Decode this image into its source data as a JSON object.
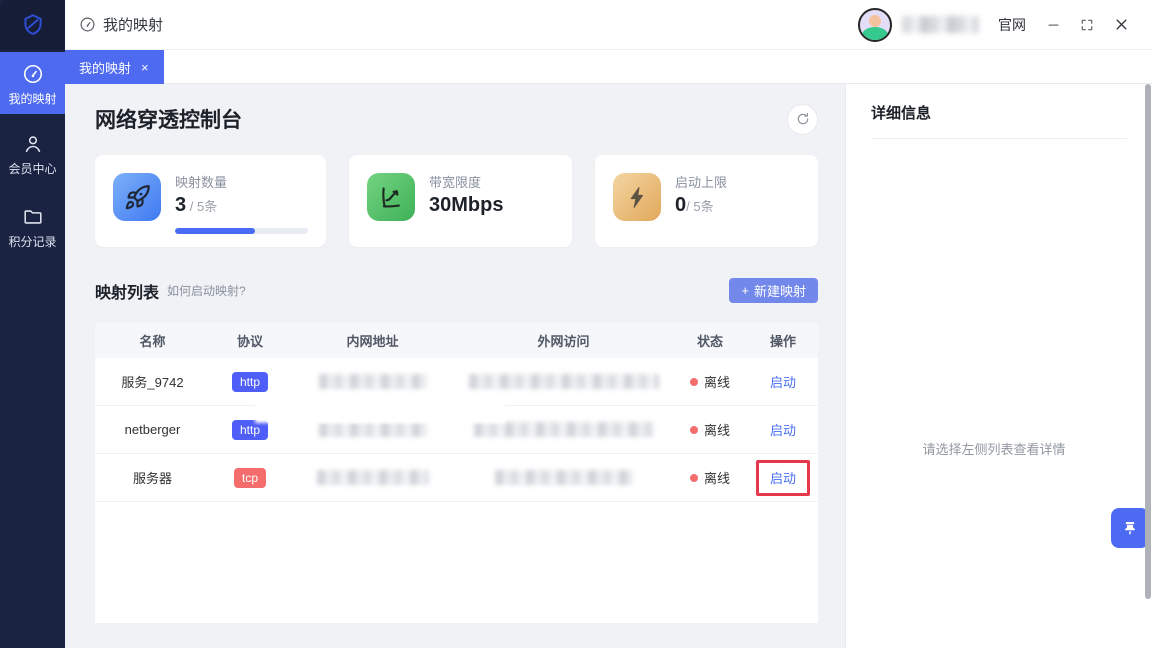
{
  "topbar": {
    "title": "我的映射",
    "portal_label": "官网"
  },
  "tab": {
    "label": "我的映射",
    "close": "×"
  },
  "sidebar": {
    "items": [
      {
        "label": "我的映射",
        "icon": "gauge-icon",
        "active": true
      },
      {
        "label": "会员中心",
        "icon": "user-icon",
        "active": false
      },
      {
        "label": "积分记录",
        "icon": "folder-icon",
        "active": false
      }
    ]
  },
  "page": {
    "title": "网络穿透控制台"
  },
  "stats": [
    {
      "label": "映射数量",
      "value": "3",
      "suffix": " / 5条",
      "icon": "rocket-icon",
      "progress_percent": 60
    },
    {
      "label": "带宽限度",
      "value": "30Mbps",
      "suffix": "",
      "icon": "trend-icon"
    },
    {
      "label": "启动上限",
      "value": "0",
      "suffix": "/ 5条",
      "icon": "bolt-icon"
    }
  ],
  "list": {
    "title": "映射列表",
    "help": "如何启动映射?",
    "new_button_plus": "+",
    "new_button_label": "新建映射"
  },
  "table": {
    "columns": [
      "名称",
      "协议",
      "内网地址",
      "外网访问",
      "状态",
      "操作"
    ],
    "rows": [
      {
        "name": "服务_9742",
        "protocol": "http",
        "status": "离线",
        "action": "启动",
        "internal_censored": true,
        "external_censored": true
      },
      {
        "name": "netberger",
        "protocol": "http",
        "status": "离线",
        "action": "启动",
        "internal_censored": true,
        "external_censored": true
      },
      {
        "name": "服务器",
        "protocol": "tcp",
        "status": "离线",
        "action": "启动",
        "internal_censored": true,
        "external_censored": true,
        "action_highlighted": true
      }
    ]
  },
  "detail": {
    "title": "详细信息",
    "empty_text": "请选择左侧列表查看详情"
  },
  "colors": {
    "sidebar_bg": "#1a2342",
    "accent_blue": "#4e6af0",
    "button_blue": "#7288ea",
    "link_blue": "#4a6ef5",
    "badge_http": "#4f5ef7",
    "badge_tcp": "#f56c6c",
    "status_offline": "#f56c6c",
    "highlight_box": "#e5394b",
    "main_bg": "#f0f2f5"
  }
}
